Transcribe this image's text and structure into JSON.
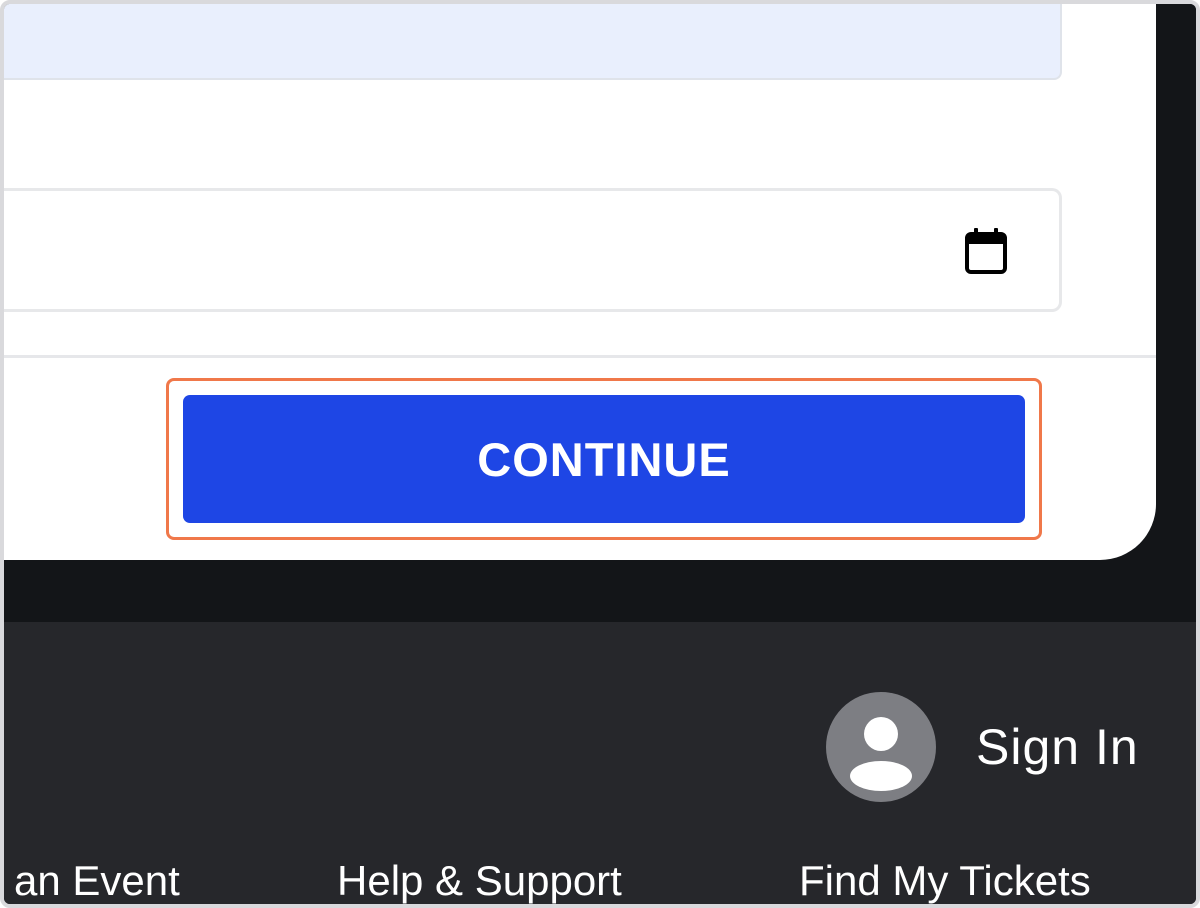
{
  "form": {
    "date_value": "",
    "date_placeholder": ""
  },
  "actions": {
    "continue_label": "CONTINUE"
  },
  "footer": {
    "sign_in_label": "Sign In",
    "links": [
      {
        "label": "an Event"
      },
      {
        "label": "Help & Support"
      },
      {
        "label": "Find My Tickets"
      }
    ]
  },
  "icons": {
    "calendar": "calendar-icon",
    "user": "user-icon"
  },
  "colors": {
    "primary_button": "#1e46e5",
    "highlight_outline": "#f0784a",
    "footer_bg": "#26272b",
    "page_bg": "#131518",
    "banner_bg": "#e9effd"
  }
}
